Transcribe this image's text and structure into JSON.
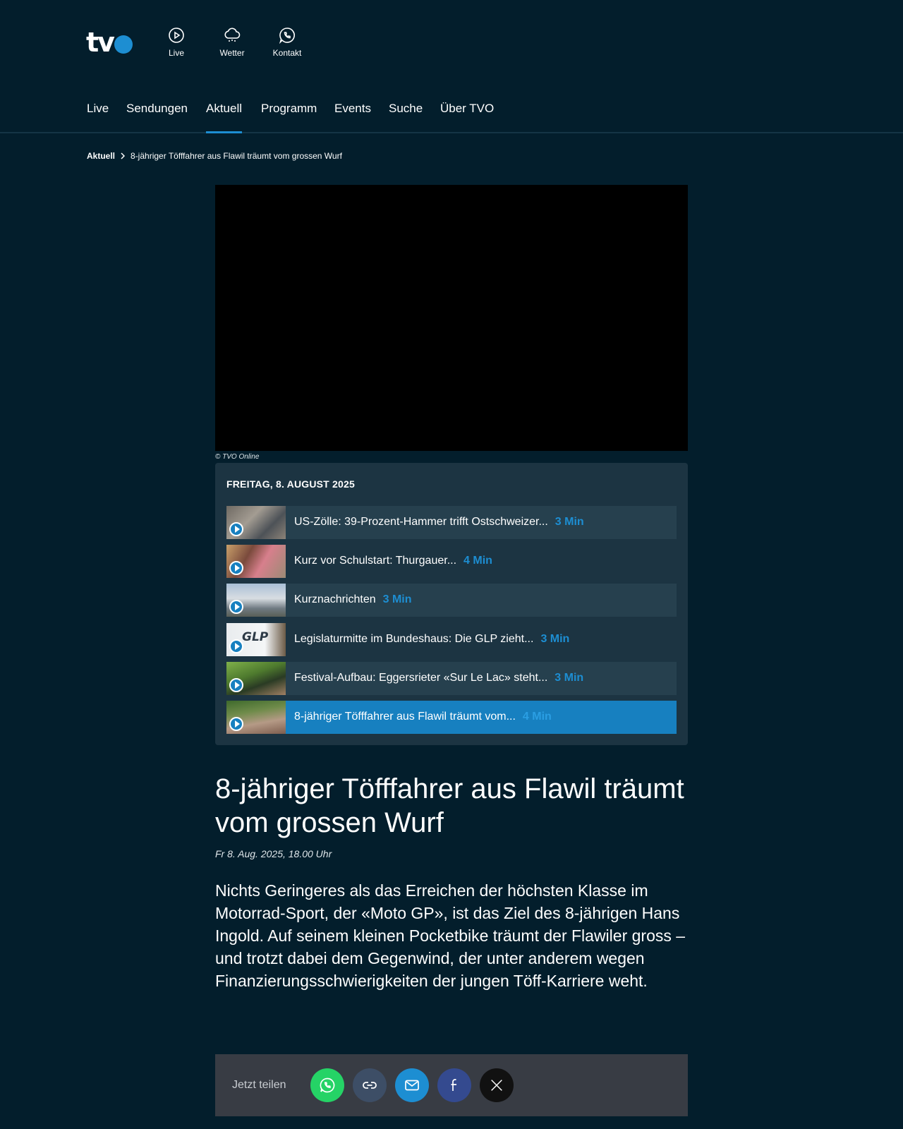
{
  "header": {
    "logo_text": "tv",
    "quick_links": [
      {
        "label": "Live",
        "icon": "play-circle-icon"
      },
      {
        "label": "Wetter",
        "icon": "cloud-rain-icon"
      },
      {
        "label": "Kontakt",
        "icon": "whatsapp-icon"
      }
    ]
  },
  "nav": {
    "items": [
      "Live",
      "Sendungen",
      "Aktuell",
      "Programm",
      "Events",
      "Suche",
      "Über TVO"
    ],
    "active": "Aktuell"
  },
  "breadcrumb": {
    "root": "Aktuell",
    "current": "8-jähriger Töfffahrer aus Flawil träumt vom grossen Wurf"
  },
  "video": {
    "credit": "© TVO Online"
  },
  "playlist": {
    "date": "FREITAG, 8. AUGUST 2025",
    "items": [
      {
        "title": "US-Zölle: 39-Prozent-Hammer trifft Ostschweizer...",
        "duration": "3 Min"
      },
      {
        "title": "Kurz vor Schulstart: Thurgauer...",
        "duration": "4 Min"
      },
      {
        "title": "Kurznachrichten",
        "duration": "3 Min"
      },
      {
        "title": "Legislaturmitte im Bundeshaus: Die GLP zieht...",
        "duration": "3 Min"
      },
      {
        "title": "Festival-Aufbau: Eggersrieter «Sur Le Lac» steht...",
        "duration": "3 Min"
      },
      {
        "title": "8-jähriger Töfffahrer aus Flawil träumt vom...",
        "duration": "4 Min"
      }
    ],
    "thumb_glp_text": "GLP"
  },
  "article": {
    "headline": "8-jähriger Töfffahrer aus Flawil träumt vom grossen Wurf",
    "date": "Fr 8. Aug. 2025, 18.00 Uhr",
    "lead": "Nichts Geringeres als das Erreichen der höchsten Klasse im Motorrad-Sport, der «Moto GP», ist das Ziel des 8-jährigen Hans Ingold. Auf seinem kleinen Pocketbike träumt der Flawiler gross – und trotzt dabei dem Gegenwind, der unter anderem wegen Finanzierungsschwierigkeiten der jungen Töff-Karriere weht."
  },
  "share": {
    "label": "Jetzt teilen",
    "buttons": [
      {
        "icon": "whatsapp-icon",
        "color": "#25d366"
      },
      {
        "icon": "link-icon",
        "color": "#3d4e66"
      },
      {
        "icon": "mail-icon",
        "color": "#1d8ed2"
      },
      {
        "icon": "facebook-icon",
        "color": "#344a8f"
      },
      {
        "icon": "x-icon",
        "color": "#111111"
      }
    ]
  },
  "colors": {
    "background": "#031e2c",
    "accent": "#1d8ed2",
    "playlist_bg": "#1c3442",
    "active_row": "#1780c0"
  }
}
